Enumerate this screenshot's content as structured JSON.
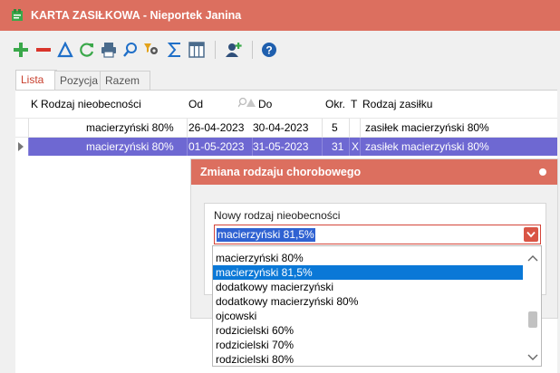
{
  "window": {
    "title": "KARTA ZASIŁKOWA - Nieportek Janina"
  },
  "toolbar": {
    "icons": [
      "plus-icon",
      "minus-icon",
      "triangle-icon",
      "refresh-icon",
      "print-icon",
      "search-icon",
      "filter-gear-icon",
      "sigma-icon",
      "columns-icon",
      "add-person-icon",
      "help-icon"
    ],
    "colors": {
      "green": "#3aa84a",
      "red": "#d9342b",
      "blue": "#1f6fc8"
    }
  },
  "tabs": [
    {
      "label": "Lista",
      "active": true
    },
    {
      "label": "Pozycja",
      "active": false
    },
    {
      "label": "Razem",
      "active": false
    }
  ],
  "grid": {
    "columns": {
      "k": "K",
      "rodzaj_nieobecnosci": "Rodzaj nieobecności",
      "od": "Od",
      "do": "Do",
      "okr": "Okr.",
      "t": "T",
      "rodzaj_zasilku": "Rodzaj zasiłku"
    },
    "rows": [
      {
        "rodzaj": "macierzyński 80%",
        "od": "26-04-2023",
        "do": "30-04-2023",
        "okr": "5",
        "t": "",
        "zasilek": "zasiłek macierzyński 80%"
      },
      {
        "rodzaj": "macierzyński 80%",
        "od": "01-05-2023",
        "do": "31-05-2023",
        "okr": "31",
        "t": "X",
        "zasilek": "zasiłek macierzyński 80%"
      }
    ],
    "selected_color": "#6e68d2"
  },
  "dialog": {
    "title": "Zmiana rodzaju chorobowego",
    "field_label": "Nowy rodzaj nieobecności",
    "field_value": "macierzyński 81,5%",
    "options": [
      "macierzyński 80%",
      "macierzyński 81,5%",
      "dodatkowy macierzyński",
      "dodatkowy macierzyński 80%",
      "ojcowski",
      "rodzicielski 60%",
      "rodzicielski 70%",
      "rodzicielski 80%"
    ],
    "selected_option": "macierzyński 81,5%",
    "title_color": "#dc6f5f"
  }
}
